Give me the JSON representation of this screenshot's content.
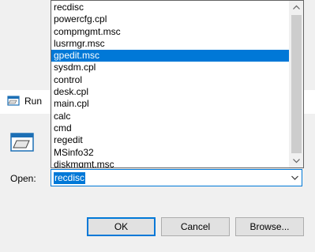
{
  "window": {
    "title": "Run",
    "icon": "run-icon"
  },
  "open_label": "Open:",
  "combo": {
    "value": "recdisc",
    "icon": "chevron-down-icon"
  },
  "dropdown": {
    "items": [
      "recdisc",
      "powercfg.cpl",
      "compmgmt.msc",
      "lusrmgr.msc",
      "gpedit.msc",
      "sysdm.cpl",
      "control",
      "desk.cpl",
      "main.cpl",
      "calc",
      "cmd",
      "regedit",
      "MSinfo32",
      "diskmgmt.msc"
    ],
    "selected_item": "gpedit.msc"
  },
  "buttons": {
    "ok": "OK",
    "cancel": "Cancel",
    "browse": "Browse..."
  },
  "colors": {
    "accent": "#0078d7",
    "background": "#f0f0f0"
  }
}
